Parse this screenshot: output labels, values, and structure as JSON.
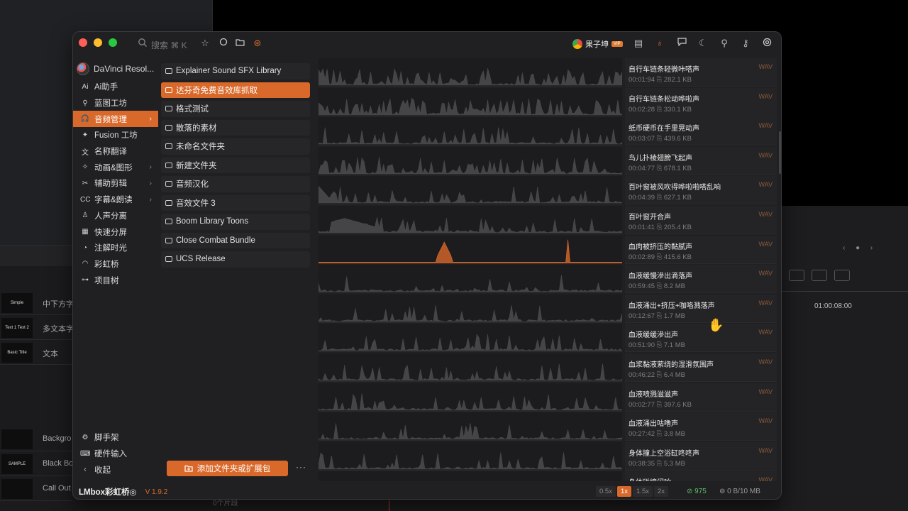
{
  "background": {
    "timecode": "01:00:08:00",
    "paging_dots": "‹ ● ›",
    "list_items": [
      {
        "thumb": "Simple",
        "label": "中下方字"
      },
      {
        "thumb": "Text 1 Text 2",
        "label": "多文本字"
      },
      {
        "thumb": "Basic Title",
        "label": "文本"
      }
    ],
    "list_items2": [
      {
        "thumb": "",
        "label": "Backgro"
      },
      {
        "thumb": "SAMPLE",
        "label": "Black Bo"
      },
      {
        "thumb": "",
        "label": "Call Out"
      }
    ],
    "bottom_text": "0个片段"
  },
  "titlebar": {
    "search_placeholder": "搜索  ⌘ K",
    "user_name": "果子坤",
    "vip_badge": "VIP"
  },
  "sidebar": {
    "app_name": "DaVinci Resol...",
    "items": [
      {
        "label": "Ai助手",
        "icon": "Ai",
        "arrow": ""
      },
      {
        "label": "蓝图工坊",
        "icon": "⚲",
        "arrow": ""
      },
      {
        "label": "音频管理",
        "icon": "🎧",
        "arrow": "›",
        "active": true
      },
      {
        "label": "Fusion 工坊",
        "icon": "✦",
        "arrow": ""
      },
      {
        "label": "名称翻译",
        "icon": "文",
        "arrow": ""
      },
      {
        "label": "动画&图形",
        "icon": "✧",
        "arrow": "›"
      },
      {
        "label": "辅助剪辑",
        "icon": "✂",
        "arrow": "›"
      },
      {
        "label": "字幕&朗读",
        "icon": "CC",
        "arrow": "›"
      },
      {
        "label": "人声分离",
        "icon": "♙",
        "arrow": ""
      },
      {
        "label": "快速分屏",
        "icon": "▦",
        "arrow": ""
      },
      {
        "label": "注解时光",
        "icon": "◔",
        "arrow": ""
      },
      {
        "label": "彩虹桥",
        "icon": "◠",
        "arrow": ""
      },
      {
        "label": "项目树",
        "icon": "⊶",
        "arrow": ""
      }
    ],
    "bottom_items": [
      {
        "label": "脚手架",
        "icon": "⚙"
      },
      {
        "label": "硬件输入",
        "icon": "⌨"
      },
      {
        "label": "收起",
        "icon": "‹"
      }
    ],
    "brand_name": "LMbox彩虹桥◎",
    "version": "V 1.9.2"
  },
  "folders": [
    "Explainer Sound SFX Library",
    "达芬奇免费音效库抓取",
    "格式测试",
    "散落的素材",
    "未命名文件夹",
    "新建文件夹",
    "音频汉化",
    "音效文件 3",
    "Boom Library Toons",
    "Close Combat Bundle",
    "UCS Release"
  ],
  "active_folder": 1,
  "add_button": "添加文件夹或扩展包",
  "more_button": "···",
  "sounds": [
    {
      "name": "自行车链条轻微咔嗒声",
      "duration": "00:01:94",
      "size": "282.1 KB",
      "format": "WAV"
    },
    {
      "name": "自行车链条松动哗啦声",
      "duration": "00:02:28",
      "size": "330.1 KB",
      "format": "WAV"
    },
    {
      "name": "纸币硬币在手里晃动声",
      "duration": "00:03:07",
      "size": "439.6 KB",
      "format": "WAV"
    },
    {
      "name": "鸟儿扑棱翅膀飞起声",
      "duration": "00:04:77",
      "size": "678.1 KB",
      "format": "WAV"
    },
    {
      "name": "百叶窗被风吹得哗啦啪嗒乱响",
      "duration": "00:04:39",
      "size": "627.1 KB",
      "format": "WAV"
    },
    {
      "name": "百叶窗开合声",
      "duration": "00:01:41",
      "size": "205.4 KB",
      "format": "WAV"
    },
    {
      "name": "血肉被挤压的黏腻声",
      "duration": "00:02:89",
      "size": "415.6 KB",
      "format": "WAV",
      "active": true
    },
    {
      "name": "血液缓慢滲出滴落声",
      "duration": "00:59:45",
      "size": "8.2 MB",
      "format": "WAV"
    },
    {
      "name": "血液涌出+挤压+咖咯溅落声",
      "duration": "00:12:67",
      "size": "1.7 MB",
      "format": "WAV"
    },
    {
      "name": "血液缓缓滲出声",
      "duration": "00:51:90",
      "size": "7.1 MB",
      "format": "WAV"
    },
    {
      "name": "血浆黏液萦绕的湿滑氛围声",
      "duration": "00:46:22",
      "size": "6.4 MB",
      "format": "WAV"
    },
    {
      "name": "血液喷溅滋滋声",
      "duration": "00:02:77",
      "size": "397.6 KB",
      "format": "WAV"
    },
    {
      "name": "血液涌出咕噜声",
      "duration": "00:27:42",
      "size": "3.8 MB",
      "format": "WAV"
    },
    {
      "name": "身体撞上空浴缸咚咚声",
      "duration": "00:38:35",
      "size": "5.3 MB",
      "format": "WAV"
    },
    {
      "name": "身体碰撞闷响",
      "duration": "",
      "size": "",
      "format": "WAV"
    }
  ],
  "status": {
    "speeds": [
      "0.5x",
      "1x",
      "1.5x",
      "2x"
    ],
    "active_speed": 1,
    "count": "975",
    "memory": "0 B/10 MB"
  },
  "colors": {
    "accent": "#d9692a",
    "wave": "#4a4a4c",
    "wave_active": "#d9692a",
    "ok": "#5bbf6a"
  }
}
